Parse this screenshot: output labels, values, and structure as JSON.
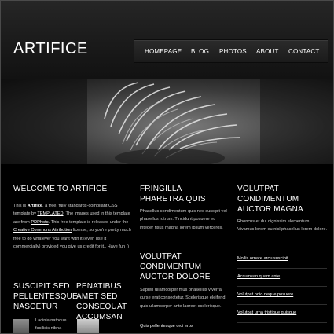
{
  "site": {
    "logo": "ARTIFICE"
  },
  "nav": {
    "items": [
      "HOMEPAGE",
      "BLOG",
      "PHOTOS",
      "ABOUT",
      "CONTACT"
    ]
  },
  "welcome": {
    "title": "WELCOME TO ARTIFICE",
    "p1": "This is ",
    "b1": "Artifice",
    "p2": ", a free, fully standards-compliant CSS template by ",
    "l1": "TEMPLATED",
    "p3": ". The images used in this template are from ",
    "l2": "PDPhoto",
    "p4": ". This free template is released under the ",
    "l3": "Creative Commons Attribution",
    "p5": " license, so you're pretty much free to do whatever you want with it (even use it commercially) provided you give us credit for it.. Have fun :)"
  },
  "col2": {
    "title1": "FRINGILLA PHARETRA QUIS",
    "text1": "Phasellus condimentum quis nec suscipit vel phasellus rutrum. Tincidunt posuere eu integer risus magna lorem ipsum verceros.",
    "title2": "VOLUTPAT CONDIMENTUM AUCTOR DOLORE",
    "text2": "Sapien ullamcorper mus phasellus viverra curse erat consectetur. Scelerisque eleifend quis ullamcorper ante laoreet scelerisque.",
    "link": "Quis pellentesque orci eros"
  },
  "col3": {
    "title": "VOLUTPAT CONDIMENTUM AUCTOR MAGNA",
    "text": "Rhoncus et dui dignissim elementum. Vivamus lorem eu nisl phasellus lorem dolore.",
    "links": [
      "Mollis ornare arcu suscipit",
      "Accumsan quam ante",
      "Volutpat odio neque posuere",
      "Volutpat urna tristique quisque"
    ]
  },
  "bottom": {
    "title1": "SUSCIPIT SED PELLENTESQUE NASCETUR",
    "title2": "PENATIBUS AMET SED CONSEQUAT ACCUMSAN",
    "caption1": "Lacinia natoque facilisis nibha"
  }
}
